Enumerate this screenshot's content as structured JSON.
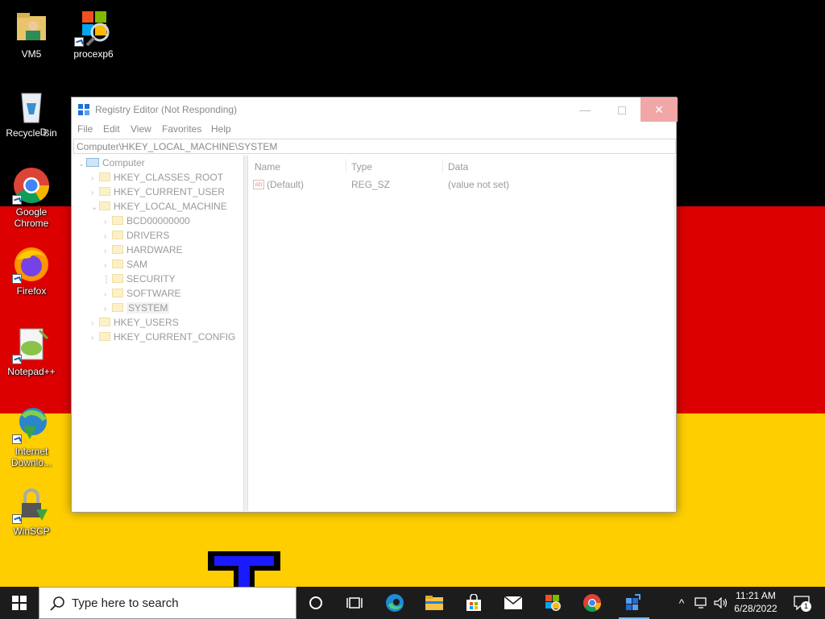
{
  "desktop": {
    "icons": [
      {
        "label": "VM5"
      },
      {
        "label": "procexp6"
      },
      {
        "label": "Recycle Bin"
      },
      {
        "label": "Google Chrome"
      },
      {
        "label": "Firefox"
      },
      {
        "label": "Notepad++"
      },
      {
        "label": "Internet Downlo..."
      },
      {
        "label": "WinSCP"
      }
    ],
    "wallpaper_colors": {
      "black": "#000000",
      "red": "#dd0000",
      "gold": "#ffce00"
    },
    "partial_label": "D"
  },
  "window": {
    "title": "Registry Editor (Not Responding)",
    "controls": {
      "minimize": "—",
      "close": "✕"
    },
    "menu": [
      "File",
      "Edit",
      "View",
      "Favorites",
      "Help"
    ],
    "address": "Computer\\HKEY_LOCAL_MACHINE\\SYSTEM",
    "tree": {
      "root": "Computer",
      "hives": [
        "HKEY_CLASSES_ROOT",
        "HKEY_CURRENT_USER",
        "HKEY_LOCAL_MACHINE"
      ],
      "hklm_children": [
        "BCD00000000",
        "DRIVERS",
        "HARDWARE",
        "SAM",
        "SECURITY",
        "SOFTWARE",
        "SYSTEM"
      ],
      "hives_after": [
        "HKEY_USERS",
        "HKEY_CURRENT_CONFIG"
      ],
      "selected": "SYSTEM"
    },
    "list": {
      "columns": [
        "Name",
        "Type",
        "Data"
      ],
      "rows": [
        {
          "name": "(Default)",
          "type": "REG_SZ",
          "data": "(value not set)"
        }
      ]
    }
  },
  "taskbar": {
    "search_placeholder": "Type here to search",
    "pinned": [
      "task-view",
      "edge",
      "file-explorer",
      "store",
      "mail",
      "explorer-app",
      "chrome",
      "regedit"
    ],
    "clock": {
      "time": "11:21 AM",
      "date": "6/28/2022"
    },
    "notification_count": "1"
  }
}
